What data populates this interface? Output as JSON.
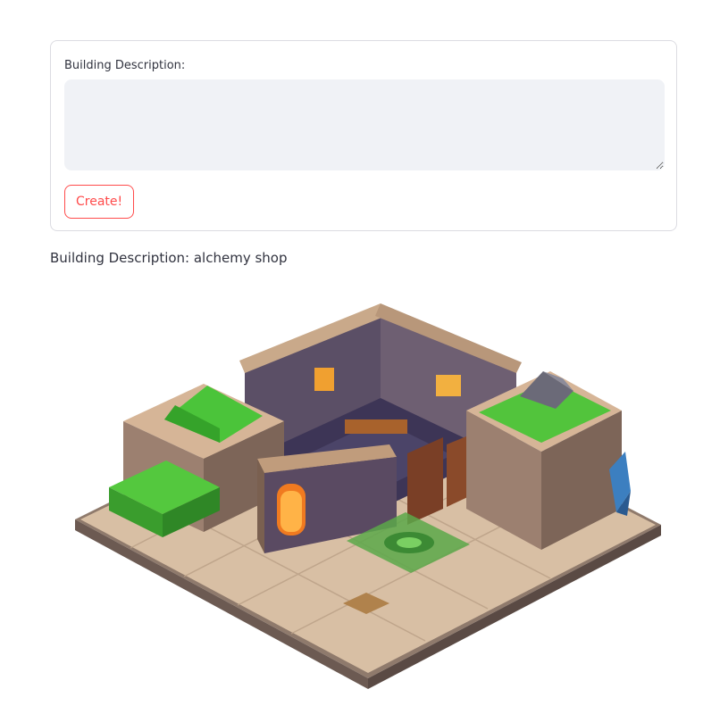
{
  "form": {
    "label": "Building Description:",
    "textarea_value": "",
    "textarea_placeholder": "",
    "button_label": "Create!"
  },
  "result": {
    "text": "Building Description: alchemy shop"
  },
  "image": {
    "alt": "Isometric alchemy shop building"
  },
  "colors": {
    "accent": "#ff4b4b",
    "input_bg": "#f0f2f6",
    "text": "#31333f"
  }
}
